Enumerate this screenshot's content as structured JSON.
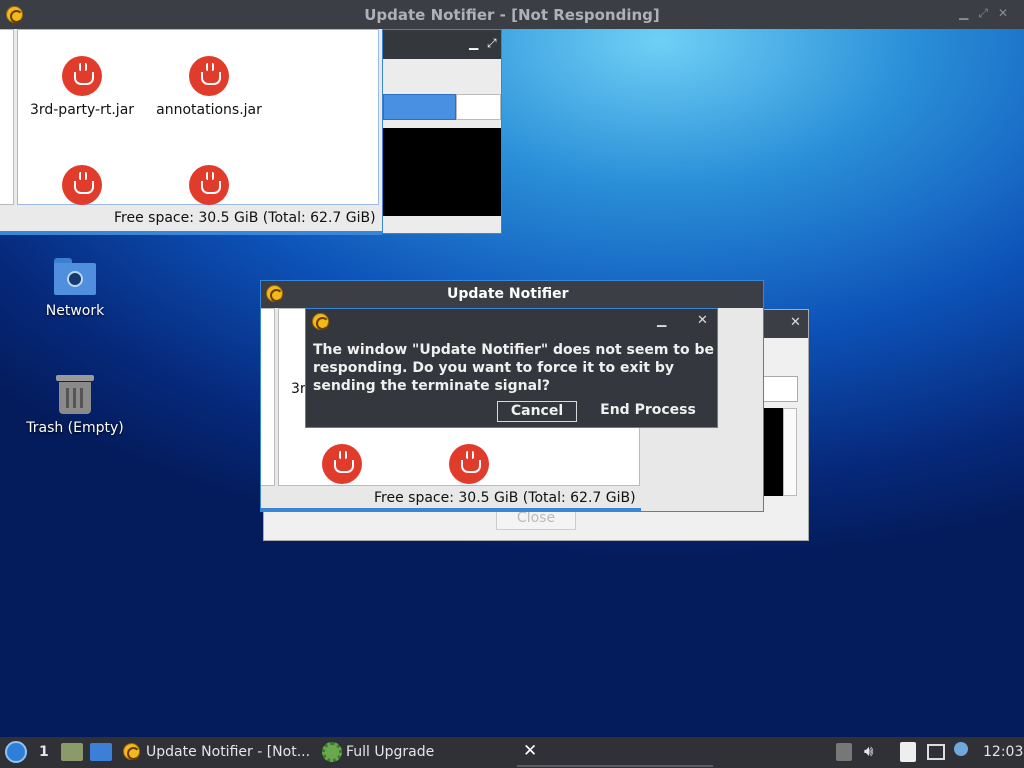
{
  "top_title": "Update Notifier - [Not Responding]",
  "file_manager": {
    "items": [
      "3rd-party-rt.jar",
      "annotations.jar"
    ],
    "status": "Free space: 30.5 GiB (Total: 62.7 GiB)"
  },
  "desktop": {
    "network_label": "Network",
    "trash_label": "Trash (Empty)"
  },
  "notifier_window": {
    "title": "Update Notifier",
    "partial_label": "3r",
    "status": "Free space: 30.5 GiB (Total: 62.7 GiB)",
    "close_label": "Close"
  },
  "alert": {
    "message": "The window \"Update Notifier\" does not seem to be responding.  Do you want to force it to exit by sending the terminate signal?",
    "cancel_label": "Cancel",
    "end_process_label": "End Process"
  },
  "taskbar": {
    "workspace": "1",
    "task1": "Update Notifier - [Not...",
    "task2": "Full Upgrade",
    "clock": "12:03"
  },
  "colors": {
    "accent": "#3a86d6",
    "titlebar": "#3b3e44",
    "jar_icon": "#e13b2c"
  }
}
